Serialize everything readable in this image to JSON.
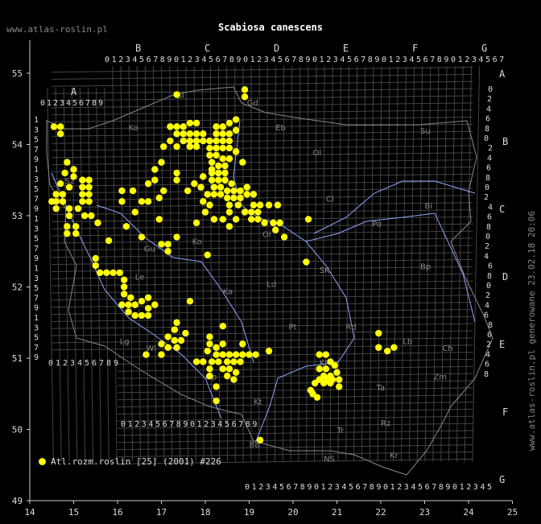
{
  "header": {
    "watermark": "www.atlas-roslin.pl",
    "title": "Scabiosa canescens",
    "generated": "www.atlas-roslin.pl generowane 23.02.18 20:06"
  },
  "legend": {
    "label": "Atl.rozm.roslin [25] (2001) #226"
  },
  "axes": {
    "lon_ticks": [
      "14",
      "15",
      "16",
      "17",
      "18",
      "19",
      "20",
      "21",
      "22",
      "23",
      "24",
      "25"
    ],
    "lat_ticks": [
      "49",
      "50",
      "51",
      "52",
      "53",
      "54",
      "55"
    ]
  },
  "grid": {
    "top_letters": [
      "B",
      "C",
      "D",
      "E",
      "F",
      "G"
    ],
    "left_letter": "A",
    "right_letters": [
      "A",
      "B",
      "C",
      "D",
      "E",
      "F",
      "G"
    ],
    "digits": [
      "0",
      "1",
      "2",
      "3",
      "4",
      "5",
      "6",
      "7",
      "8",
      "9"
    ],
    "left_rows": [
      "1",
      "3",
      "5",
      "7",
      "9",
      "1",
      "3",
      "5",
      "7",
      "9",
      "1",
      "3",
      "5",
      "7",
      "9",
      "1",
      "3",
      "5",
      "7",
      "9",
      "1",
      "3",
      "5",
      "7",
      "9"
    ]
  },
  "regions": [
    {
      "code": "Sl",
      "lon": 17.35,
      "lat": 54.65
    },
    {
      "code": "Gd",
      "lon": 18.95,
      "lat": 54.55
    },
    {
      "code": "Ko",
      "lon": 16.25,
      "lat": 54.2
    },
    {
      "code": "Eb",
      "lon": 19.6,
      "lat": 54.2
    },
    {
      "code": "Su",
      "lon": 22.9,
      "lat": 54.15
    },
    {
      "code": "Ol",
      "lon": 20.45,
      "lat": 53.85
    },
    {
      "code": "Sz",
      "lon": 14.8,
      "lat": 53.45
    },
    {
      "code": "Ci",
      "lon": 20.75,
      "lat": 53.2
    },
    {
      "code": "Bi",
      "lon": 23.0,
      "lat": 53.1
    },
    {
      "code": "Po",
      "lon": 21.8,
      "lat": 52.85
    },
    {
      "code": "Ol",
      "lon": 19.3,
      "lat": 52.7
    },
    {
      "code": "Ko",
      "lon": 17.7,
      "lat": 52.6
    },
    {
      "code": "Gu",
      "lon": 16.6,
      "lat": 52.5
    },
    {
      "code": "SK",
      "lon": 20.6,
      "lat": 52.2
    },
    {
      "code": "Bp",
      "lon": 22.9,
      "lat": 52.25
    },
    {
      "code": "Le",
      "lon": 16.4,
      "lat": 52.1
    },
    {
      "code": "Ka",
      "lon": 18.4,
      "lat": 51.9
    },
    {
      "code": "Ld",
      "lon": 19.4,
      "lat": 52.0
    },
    {
      "code": "Pt",
      "lon": 19.9,
      "lat": 51.4
    },
    {
      "code": "Rd",
      "lon": 21.2,
      "lat": 51.4
    },
    {
      "code": "Lb",
      "lon": 22.5,
      "lat": 51.2
    },
    {
      "code": "Ch",
      "lon": 23.4,
      "lat": 51.1
    },
    {
      "code": "Kl",
      "lon": 20.6,
      "lat": 50.9
    },
    {
      "code": "Zm",
      "lon": 23.2,
      "lat": 50.7
    },
    {
      "code": "Ta",
      "lon": 21.9,
      "lat": 50.55
    },
    {
      "code": "Kt",
      "lon": 19.1,
      "lat": 50.35
    },
    {
      "code": "Tr",
      "lon": 21.0,
      "lat": 49.95
    },
    {
      "code": "Rz",
      "lon": 22.0,
      "lat": 50.05
    },
    {
      "code": "BB",
      "lon": 19.0,
      "lat": 49.75
    },
    {
      "code": "NS",
      "lon": 20.7,
      "lat": 49.55
    },
    {
      "code": "Kr",
      "lon": 22.2,
      "lat": 49.6
    },
    {
      "code": "Lg",
      "lon": 16.05,
      "lat": 51.2
    },
    {
      "code": "Wl",
      "lon": 16.65,
      "lat": 51.1
    },
    {
      "code": "Op",
      "lon": 18.0,
      "lat": 50.7
    }
  ],
  "records": [
    [
      17.35,
      54.7
    ],
    [
      18.9,
      54.77
    ],
    [
      18.9,
      54.67
    ],
    [
      14.55,
      54.25
    ],
    [
      14.7,
      54.25
    ],
    [
      14.7,
      54.15
    ],
    [
      17.2,
      54.25
    ],
    [
      17.35,
      54.25
    ],
    [
      17.5,
      54.25
    ],
    [
      17.65,
      54.3
    ],
    [
      17.8,
      54.3
    ],
    [
      17.35,
      54.15
    ],
    [
      17.5,
      54.15
    ],
    [
      17.65,
      54.15
    ],
    [
      17.8,
      54.15
    ],
    [
      17.95,
      54.15
    ],
    [
      17.2,
      54.05
    ],
    [
      17.5,
      54.05
    ],
    [
      17.65,
      54.05
    ],
    [
      17.8,
      54.05
    ],
    [
      17.95,
      54.05
    ],
    [
      17.05,
      53.97
    ],
    [
      17.35,
      53.97
    ],
    [
      17.65,
      53.97
    ],
    [
      17.8,
      53.97
    ],
    [
      18.25,
      54.25
    ],
    [
      18.4,
      54.25
    ],
    [
      18.55,
      54.3
    ],
    [
      18.7,
      54.35
    ],
    [
      18.25,
      54.15
    ],
    [
      18.4,
      54.15
    ],
    [
      18.55,
      54.15
    ],
    [
      18.7,
      54.2
    ],
    [
      18.1,
      54.05
    ],
    [
      18.25,
      54.05
    ],
    [
      18.4,
      54.05
    ],
    [
      18.55,
      54.05
    ],
    [
      18.1,
      53.95
    ],
    [
      18.25,
      53.95
    ],
    [
      18.4,
      53.95
    ],
    [
      18.55,
      53.95
    ],
    [
      18.7,
      53.9
    ],
    [
      18.1,
      53.85
    ],
    [
      18.25,
      53.85
    ],
    [
      18.4,
      53.8
    ],
    [
      18.55,
      53.8
    ],
    [
      18.85,
      53.75
    ],
    [
      18.15,
      53.75
    ],
    [
      18.3,
      53.7
    ],
    [
      18.45,
      53.7
    ],
    [
      18.15,
      53.6
    ],
    [
      18.3,
      53.6
    ],
    [
      18.45,
      53.6
    ],
    [
      18.15,
      53.5
    ],
    [
      18.3,
      53.5
    ],
    [
      18.45,
      53.5
    ],
    [
      18.6,
      53.45
    ],
    [
      18.2,
      53.4
    ],
    [
      18.35,
      53.4
    ],
    [
      18.5,
      53.35
    ],
    [
      18.65,
      53.35
    ],
    [
      18.8,
      53.35
    ],
    [
      18.95,
      53.4
    ],
    [
      17.9,
      53.4
    ],
    [
      18.05,
      53.3
    ],
    [
      18.2,
      53.3
    ],
    [
      18.35,
      53.3
    ],
    [
      18.5,
      53.25
    ],
    [
      18.65,
      53.25
    ],
    [
      18.8,
      53.25
    ],
    [
      18.95,
      53.3
    ],
    [
      19.1,
      53.3
    ],
    [
      17.95,
      53.2
    ],
    [
      18.1,
      53.15
    ],
    [
      18.55,
      53.15
    ],
    [
      18.75,
      53.15
    ],
    [
      19.1,
      53.15
    ],
    [
      19.25,
      53.15
    ],
    [
      19.45,
      53.15
    ],
    [
      19.65,
      53.15
    ],
    [
      18.0,
      53.05
    ],
    [
      18.55,
      53.05
    ],
    [
      18.9,
      53.05
    ],
    [
      19.05,
      53.05
    ],
    [
      19.2,
      53.05
    ],
    [
      18.2,
      52.95
    ],
    [
      18.4,
      52.95
    ],
    [
      18.7,
      52.95
    ],
    [
      19.05,
      52.95
    ],
    [
      19.2,
      52.95
    ],
    [
      19.35,
      52.9
    ],
    [
      19.55,
      52.9
    ],
    [
      19.7,
      52.9
    ],
    [
      17.8,
      52.9
    ],
    [
      18.55,
      52.85
    ],
    [
      19.6,
      52.8
    ],
    [
      19.8,
      52.7
    ],
    [
      20.35,
      52.95
    ],
    [
      14.85,
      53.75
    ],
    [
      15.0,
      53.65
    ],
    [
      14.8,
      53.6
    ],
    [
      15.0,
      53.55
    ],
    [
      15.2,
      53.5
    ],
    [
      15.35,
      53.5
    ],
    [
      14.7,
      53.45
    ],
    [
      14.9,
      53.4
    ],
    [
      15.2,
      53.4
    ],
    [
      15.35,
      53.4
    ],
    [
      14.6,
      53.3
    ],
    [
      14.75,
      53.3
    ],
    [
      15.2,
      53.3
    ],
    [
      15.35,
      53.3
    ],
    [
      14.5,
      53.2
    ],
    [
      14.6,
      53.2
    ],
    [
      14.75,
      53.2
    ],
    [
      15.2,
      53.2
    ],
    [
      15.35,
      53.2
    ],
    [
      14.6,
      53.1
    ],
    [
      14.9,
      53.1
    ],
    [
      15.1,
      53.1
    ],
    [
      14.9,
      53.0
    ],
    [
      15.25,
      53.0
    ],
    [
      15.4,
      53.0
    ],
    [
      15.55,
      52.9
    ],
    [
      14.85,
      52.85
    ],
    [
      15.05,
      52.85
    ],
    [
      14.85,
      52.75
    ],
    [
      15.05,
      52.75
    ],
    [
      16.1,
      53.35
    ],
    [
      16.35,
      53.35
    ],
    [
      16.1,
      53.2
    ],
    [
      16.4,
      53.05
    ],
    [
      16.55,
      53.2
    ],
    [
      16.7,
      53.2
    ],
    [
      16.7,
      53.45
    ],
    [
      16.85,
      53.5
    ],
    [
      16.85,
      53.65
    ],
    [
      17.0,
      53.75
    ],
    [
      17.05,
      53.35
    ],
    [
      16.95,
      53.25
    ],
    [
      17.35,
      53.5
    ],
    [
      17.35,
      53.6
    ],
    [
      17.95,
      53.55
    ],
    [
      18.15,
      53.65
    ],
    [
      17.6,
      53.35
    ],
    [
      17.75,
      53.45
    ],
    [
      16.95,
      52.95
    ],
    [
      16.2,
      52.85
    ],
    [
      16.55,
      52.7
    ],
    [
      17.35,
      52.7
    ],
    [
      15.8,
      52.65
    ],
    [
      17.0,
      52.6
    ],
    [
      17.15,
      52.6
    ],
    [
      17.15,
      52.5
    ],
    [
      15.5,
      52.4
    ],
    [
      15.5,
      52.3
    ],
    [
      15.6,
      52.2
    ],
    [
      15.75,
      52.2
    ],
    [
      15.9,
      52.2
    ],
    [
      16.05,
      52.2
    ],
    [
      16.15,
      52.1
    ],
    [
      16.15,
      52.0
    ],
    [
      16.15,
      51.9
    ],
    [
      16.3,
      51.85
    ],
    [
      16.1,
      51.75
    ],
    [
      16.25,
      51.75
    ],
    [
      16.4,
      51.75
    ],
    [
      16.55,
      51.8
    ],
    [
      16.7,
      51.85
    ],
    [
      16.25,
      51.65
    ],
    [
      16.4,
      51.6
    ],
    [
      16.55,
      51.6
    ],
    [
      16.7,
      51.7
    ],
    [
      16.85,
      51.75
    ],
    [
      16.7,
      51.6
    ],
    [
      17.65,
      51.8
    ],
    [
      18.05,
      52.45
    ],
    [
      17.35,
      51.5
    ],
    [
      17.3,
      51.4
    ],
    [
      17.55,
      51.35
    ],
    [
      17.15,
      51.3
    ],
    [
      17.3,
      51.25
    ],
    [
      17.45,
      51.25
    ],
    [
      17.0,
      51.2
    ],
    [
      17.15,
      51.15
    ],
    [
      17.35,
      51.15
    ],
    [
      17.0,
      51.05
    ],
    [
      18.4,
      51.45
    ],
    [
      18.1,
      51.3
    ],
    [
      18.1,
      51.2
    ],
    [
      18.25,
      51.15
    ],
    [
      18.4,
      51.2
    ],
    [
      18.85,
      51.2
    ],
    [
      18.05,
      51.1
    ],
    [
      18.25,
      51.05
    ],
    [
      18.4,
      51.05
    ],
    [
      18.55,
      51.05
    ],
    [
      18.7,
      51.05
    ],
    [
      18.85,
      51.05
    ],
    [
      19.0,
      51.05
    ],
    [
      19.15,
      51.05
    ],
    [
      19.45,
      51.1
    ],
    [
      17.8,
      50.95
    ],
    [
      17.95,
      50.95
    ],
    [
      18.15,
      50.95
    ],
    [
      18.3,
      50.95
    ],
    [
      18.5,
      50.95
    ],
    [
      18.65,
      50.95
    ],
    [
      18.8,
      50.95
    ],
    [
      18.1,
      50.85
    ],
    [
      18.4,
      50.85
    ],
    [
      18.55,
      50.85
    ],
    [
      18.7,
      50.8
    ],
    [
      18.1,
      50.75
    ],
    [
      18.5,
      50.75
    ],
    [
      18.65,
      50.7
    ],
    [
      18.25,
      50.6
    ],
    [
      18.25,
      50.4
    ],
    [
      16.65,
      51.05
    ],
    [
      19.25,
      49.85
    ],
    [
      20.6,
      51.05
    ],
    [
      20.75,
      51.05
    ],
    [
      20.85,
      50.95
    ],
    [
      20.6,
      50.85
    ],
    [
      20.75,
      50.85
    ],
    [
      20.95,
      50.9
    ],
    [
      20.7,
      50.75
    ],
    [
      20.85,
      50.75
    ],
    [
      21.0,
      50.8
    ],
    [
      20.6,
      50.7
    ],
    [
      20.75,
      50.7
    ],
    [
      20.9,
      50.7
    ],
    [
      21.05,
      50.7
    ],
    [
      20.5,
      50.65
    ],
    [
      20.7,
      50.65
    ],
    [
      20.85,
      50.65
    ],
    [
      21.05,
      50.6
    ],
    [
      20.4,
      50.55
    ],
    [
      20.55,
      50.45
    ],
    [
      20.45,
      50.5
    ],
    [
      21.95,
      51.35
    ],
    [
      21.95,
      51.15
    ],
    [
      22.15,
      51.1
    ],
    [
      22.3,
      51.15
    ],
    [
      20.3,
      52.35
    ]
  ]
}
